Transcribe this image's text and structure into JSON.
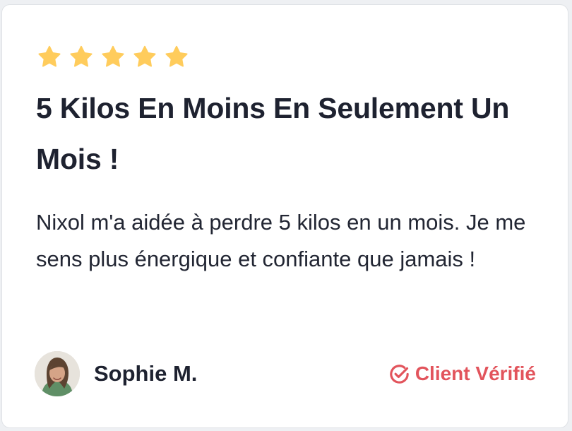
{
  "review": {
    "rating": 5,
    "max_rating": 5,
    "title": "5 Kilos En Moins En Seulement Un Mois !",
    "body": "Nixol m'a aidée à perdre 5 kilos en un mois. Je me sens plus énergique et confiante que jamais !",
    "author": "Sophie M.",
    "badge": "Client Vérifié"
  },
  "colors": {
    "star": "#ffcc5c",
    "badge": "#e2545c",
    "title": "#1e2230",
    "card_background": "#ffffff"
  },
  "icons": {
    "rating": "star-icon",
    "verified": "check-circle-icon"
  }
}
